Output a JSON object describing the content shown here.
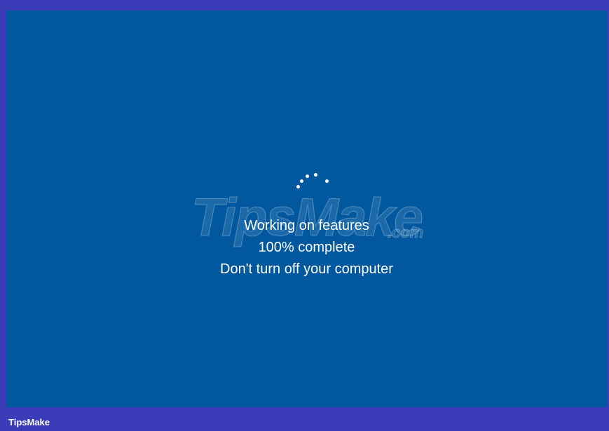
{
  "progress": {
    "title": "Working on features",
    "percent_text": "100% complete",
    "warning": "Don't turn off your computer"
  },
  "watermark": {
    "main": "TipsMake",
    "suffix": ".com"
  },
  "footer": {
    "brand": "TipsMake"
  },
  "colors": {
    "screen_background": "#02589f",
    "frame_border": "#3a3cb8",
    "text": "#ffffff"
  },
  "icons": {
    "spinner": "loading-dots-icon"
  }
}
